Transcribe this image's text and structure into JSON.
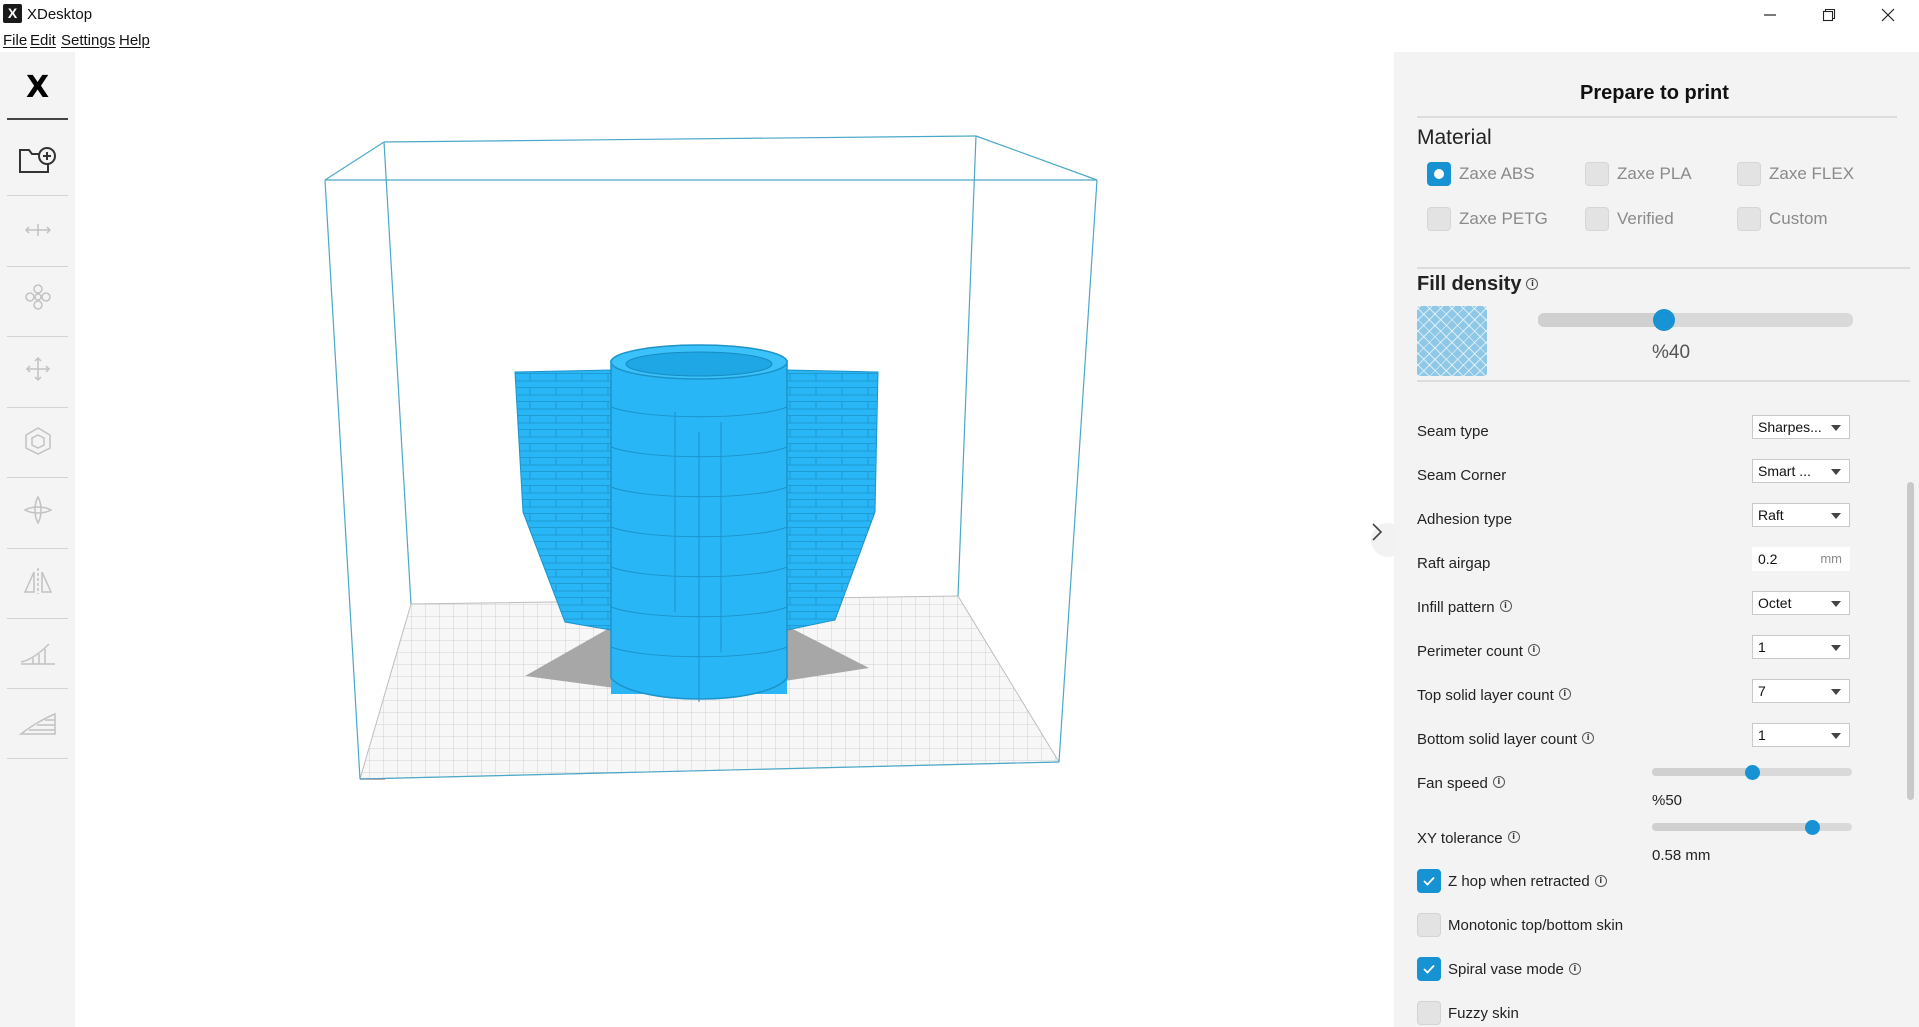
{
  "window": {
    "title": "XDesktop",
    "logo_glyph": "X",
    "controls": [
      "minimize-icon",
      "maximize-icon",
      "close-icon"
    ]
  },
  "menu": {
    "items": [
      "File",
      "Edit",
      "Settings",
      "Help"
    ]
  },
  "toolbar": {
    "logo": "X",
    "tools": [
      "add-folder-icon",
      "move-center-icon",
      "arrange-icon",
      "move-icon",
      "scale-icon",
      "rotate-icon",
      "mirror-icon",
      "support-icon",
      "layer-icon"
    ]
  },
  "panel": {
    "title": "Prepare to print",
    "material": {
      "title": "Material",
      "options": [
        {
          "label": "Zaxe ABS",
          "selected": true
        },
        {
          "label": "Zaxe PLA",
          "selected": false
        },
        {
          "label": "Zaxe FLEX",
          "selected": false
        },
        {
          "label": "Zaxe PETG",
          "selected": false
        },
        {
          "label": "Verified",
          "selected": false
        },
        {
          "label": "Custom",
          "selected": false
        }
      ]
    },
    "fill_density": {
      "title": "Fill density",
      "value_text": "%40",
      "value": 40
    },
    "settings": {
      "seam_type": {
        "label": "Seam type",
        "value": "Sharpes..."
      },
      "seam_corner": {
        "label": "Seam Corner",
        "value": "Smart ..."
      },
      "adhesion_type": {
        "label": "Adhesion type",
        "value": "Raft"
      },
      "raft_airgap": {
        "label": "Raft airgap",
        "value": "0.2",
        "unit": "mm"
      },
      "infill_pattern": {
        "label": "Infill pattern",
        "value": "Octet"
      },
      "perimeter_count": {
        "label": "Perimeter count",
        "value": "1"
      },
      "top_solid_layer_count": {
        "label": "Top solid layer count",
        "value": "7"
      },
      "bottom_solid_layer_count": {
        "label": "Bottom solid layer count",
        "value": "1"
      },
      "fan_speed": {
        "label": "Fan speed",
        "value_text": "%50",
        "value": 50
      },
      "xy_tolerance": {
        "label": "XY tolerance",
        "value_text": "0.58 mm",
        "value": 0.8
      }
    },
    "checkboxes": [
      {
        "label": "Z hop when retracted",
        "checked": true,
        "info": true
      },
      {
        "label": "Monotonic top/bottom skin",
        "checked": false,
        "info": false
      },
      {
        "label": "Spiral vase mode",
        "checked": true,
        "info": true
      },
      {
        "label": "Fuzzy skin",
        "checked": false,
        "info": false
      }
    ]
  },
  "colors": {
    "accent": "#1793d3",
    "model": "#29b6f6",
    "build_volume": "#4aa8c8",
    "panel_bg": "#f3f3f3"
  }
}
